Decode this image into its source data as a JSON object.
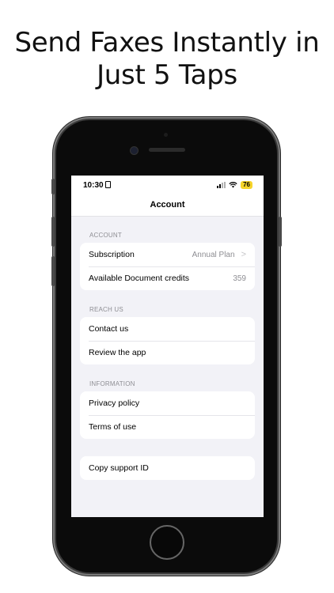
{
  "headline": {
    "line1": "Send Faxes Instantly in",
    "line2": "Just 5 Taps"
  },
  "status_bar": {
    "time": "10:30",
    "battery": "76"
  },
  "nav": {
    "title": "Account"
  },
  "sections": {
    "account": {
      "title": "ACCOUNT",
      "subscription": {
        "label": "Subscription",
        "value": "Annual Plan",
        "chevron": ">"
      },
      "credits": {
        "label": "Available Document credits",
        "value": "359"
      }
    },
    "reach_us": {
      "title": "REACH US",
      "contact": {
        "label": "Contact us"
      },
      "review": {
        "label": "Review the app"
      }
    },
    "information": {
      "title": "INFORMATION",
      "privacy": {
        "label": "Privacy policy"
      },
      "terms": {
        "label": "Terms of use"
      }
    },
    "support": {
      "copy": {
        "label": "Copy support ID"
      }
    }
  },
  "colors": {
    "accent_battery": "#f6d42b",
    "screen_bg": "#f2f2f7",
    "secondary_text": "#8e8e93"
  }
}
